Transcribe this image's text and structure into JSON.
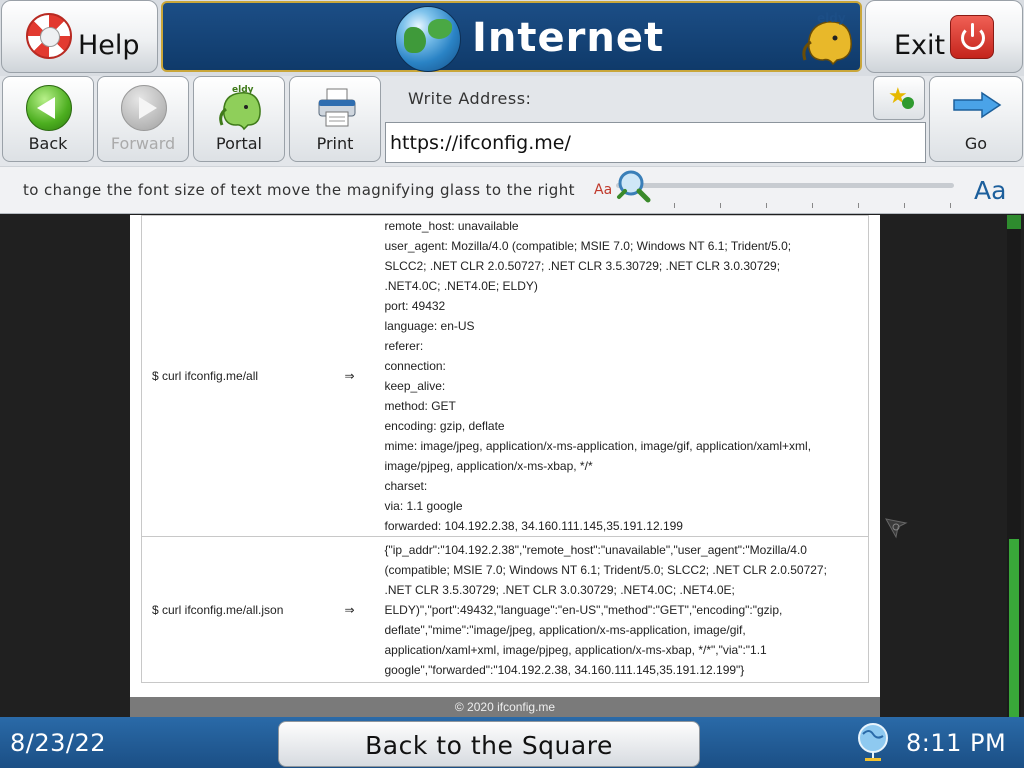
{
  "header": {
    "help_label": "Help",
    "title": "Internet",
    "logo_text": "eldy",
    "exit_label": "Exit"
  },
  "toolbar": {
    "back_label": "Back",
    "forward_label": "Forward",
    "portal_label": "Portal",
    "print_label": "Print",
    "address_label": "Write Address:",
    "address_value": "https://ifconfig.me/",
    "go_label": "Go"
  },
  "fontbar": {
    "hint": "to change the font size of text move the magnifying glass to the right",
    "small_aa": "Aa",
    "large_aa": "Aa",
    "slider_level": 0
  },
  "page": {
    "rows": [
      {
        "command": "$ curl ifconfig.me/all",
        "arrow": "⇒",
        "lines": [
          "remote_host: unavailable",
          "user_agent: Mozilla/4.0 (compatible; MSIE 7.0; Windows NT 6.1; Trident/5.0;",
          "SLCC2; .NET CLR 2.0.50727; .NET CLR 3.5.30729; .NET CLR 3.0.30729;",
          ".NET4.0C; .NET4.0E; ELDY)",
          "port: 49432",
          "language: en-US",
          "referer:",
          "connection:",
          "keep_alive:",
          "method: GET",
          "encoding: gzip, deflate",
          "mime: image/jpeg, application/x-ms-application, image/gif, application/xaml+xml,",
          "image/pjpeg, application/x-ms-xbap, */*",
          "charset:",
          "via: 1.1 google",
          "forwarded: 104.192.2.38, 34.160.111.145,35.191.12.199"
        ]
      },
      {
        "command": "$ curl ifconfig.me/all.json",
        "arrow": "⇒",
        "lines": [
          "{\"ip_addr\":\"104.192.2.38\",\"remote_host\":\"unavailable\",\"user_agent\":\"Mozilla/4.0",
          "(compatible; MSIE 7.0; Windows NT 6.1; Trident/5.0; SLCC2; .NET CLR 2.0.50727;",
          ".NET CLR 3.5.30729; .NET CLR 3.0.30729; .NET4.0C; .NET4.0E;",
          "ELDY)\",\"port\":49432,\"language\":\"en-US\",\"method\":\"GET\",\"encoding\":\"gzip,",
          "deflate\",\"mime\":\"image/jpeg, application/x-ms-application, image/gif,",
          "application/xaml+xml, image/pjpeg, application/x-ms-xbap, */*\",\"via\":\"1.1",
          "google\",\"forwarded\":\"104.192.2.38, 34.160.111.145,35.191.12.199\"}"
        ]
      }
    ],
    "footer": "© 2020 ifconfig.me"
  },
  "bottombar": {
    "date": "8/23/22",
    "square_label": "Back to the Square",
    "time": "8:11 PM"
  },
  "colors": {
    "title_bg": "#1c4e86",
    "title_border": "#c9a63a",
    "bottom_bg": "#2a6aa8",
    "scroll_green": "#39a839"
  }
}
